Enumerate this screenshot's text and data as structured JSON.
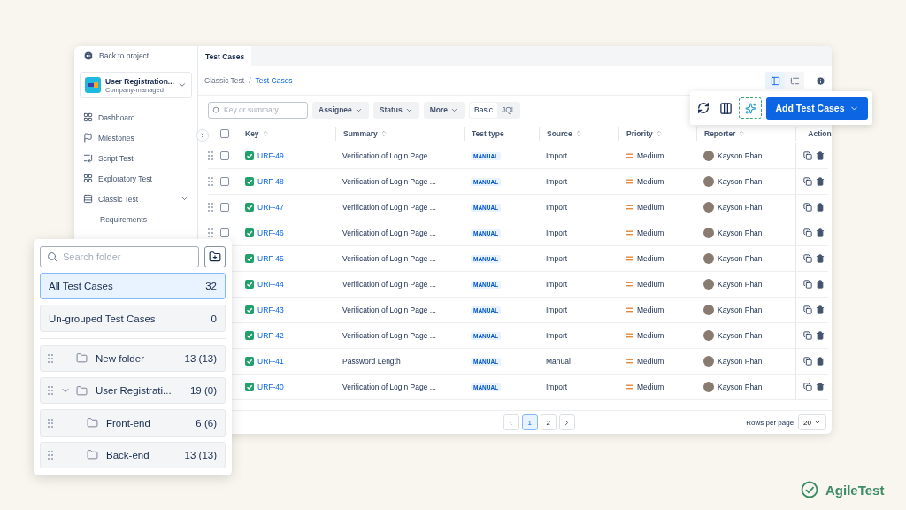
{
  "sidebar": {
    "back_link": "Back to project",
    "project": {
      "name": "User Registration...",
      "type": "Company-managed"
    },
    "items": [
      {
        "label": "Dashboard"
      },
      {
        "label": "Milestones"
      },
      {
        "label": "Script Test"
      },
      {
        "label": "Exploratory Test"
      },
      {
        "label": "Classic Test",
        "expanded": true,
        "children": [
          {
            "label": "Requirements"
          }
        ]
      }
    ]
  },
  "tabs": [
    {
      "label": "Test Cases",
      "selected": true
    }
  ],
  "breadcrumb": [
    "Classic Test",
    "Test Cases"
  ],
  "breadcrumb_separator": "/",
  "view_toggle": [
    {
      "selected": true
    },
    {
      "selected": false
    }
  ],
  "search": {
    "placeholder": "Key or summary"
  },
  "filters": [
    "Assignee",
    "Status",
    "More"
  ],
  "query_mode": [
    {
      "label": "Basic",
      "selected": true
    },
    {
      "label": "JQL",
      "selected": false
    }
  ],
  "add_button": "Add Test Cases",
  "table": {
    "select_all": {
      "checked": false
    },
    "columns": [
      {
        "label": "Key",
        "sortable": true
      },
      {
        "label": "Summary",
        "sortable": true
      },
      {
        "label": "Test type",
        "sortable": false
      },
      {
        "label": "Source",
        "sortable": true
      },
      {
        "label": "Priority",
        "sortable": true
      },
      {
        "label": "Reporter",
        "sortable": true
      },
      {
        "label": "Action",
        "sortable": false
      }
    ],
    "rows": [
      {
        "key": "URF-49",
        "summary": "Verification of Login Page ...",
        "test_type": "MANUAL",
        "source": "Import",
        "priority": "Medium",
        "reporter": "Kayson Phan",
        "checked": false
      },
      {
        "key": "URF-48",
        "summary": "Verification of Login Page ...",
        "test_type": "MANUAL",
        "source": "Import",
        "priority": "Medium",
        "reporter": "Kayson Phan",
        "checked": false
      },
      {
        "key": "URF-47",
        "summary": "Verification of Login Page ...",
        "test_type": "MANUAL",
        "source": "Import",
        "priority": "Medium",
        "reporter": "Kayson Phan",
        "checked": false
      },
      {
        "key": "URF-46",
        "summary": "Verification of Login Page ...",
        "test_type": "MANUAL",
        "source": "Import",
        "priority": "Medium",
        "reporter": "Kayson Phan",
        "checked": false
      },
      {
        "key": "URF-45",
        "summary": "Verification of Login Page ...",
        "test_type": "MANUAL",
        "source": "Import",
        "priority": "Medium",
        "reporter": "Kayson Phan"
      },
      {
        "key": "URF-44",
        "summary": "Verification of Login Page ...",
        "test_type": "MANUAL",
        "source": "Import",
        "priority": "Medium",
        "reporter": "Kayson Phan"
      },
      {
        "key": "URF-43",
        "summary": "Verification of Login Page ...",
        "test_type": "MANUAL",
        "source": "Import",
        "priority": "Medium",
        "reporter": "Kayson Phan"
      },
      {
        "key": "URF-42",
        "summary": "Verification of Login Page ...",
        "test_type": "MANUAL",
        "source": "Import",
        "priority": "Medium",
        "reporter": "Kayson Phan"
      },
      {
        "key": "URF-41",
        "summary": "Password Length",
        "test_type": "MANUAL",
        "source": "Manual",
        "priority": "Medium",
        "reporter": "Kayson Phan"
      },
      {
        "key": "URF-40",
        "summary": "Verification of Login Page ...",
        "test_type": "MANUAL",
        "source": "Import",
        "priority": "Medium",
        "reporter": "Kayson Phan"
      }
    ]
  },
  "pagination": {
    "pages": [
      {
        "label": "1",
        "selected": true
      },
      {
        "label": "2",
        "selected": false
      }
    ],
    "rows_per_page_label": "Rows per page",
    "rows_per_page": "20"
  },
  "folder_panel": {
    "search": {
      "placeholder": "Search folder"
    },
    "summary": [
      {
        "label": "All Test Cases",
        "count": "32",
        "selected": true
      },
      {
        "label": "Un-grouped Test Cases",
        "count": "0",
        "selected": false
      }
    ],
    "folders": [
      {
        "name": "New folder",
        "count": "13 (13)"
      },
      {
        "name": "User Registrati...",
        "count": "19 (0)",
        "expanded": true,
        "children": [
          {
            "name": "Front-end",
            "count": "6 (6)"
          },
          {
            "name": "Back-end",
            "count": "13 (13)"
          }
        ]
      }
    ]
  },
  "brand": "AgileTest"
}
